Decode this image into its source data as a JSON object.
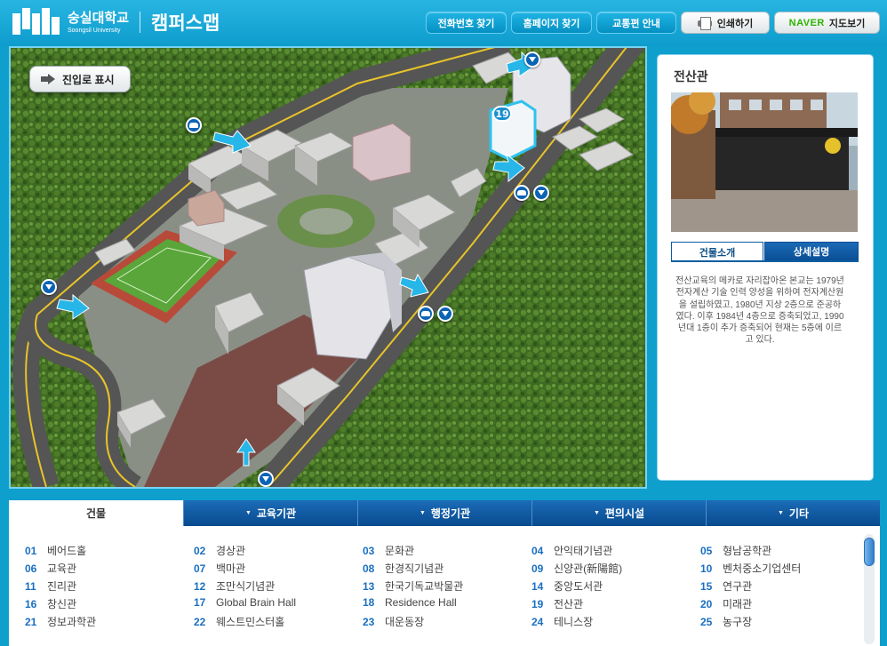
{
  "header": {
    "logo_kr": "숭실대학교",
    "logo_en": "Soongsil University",
    "page_title": "캠퍼스맵",
    "buttons": {
      "phone": "전화번호 찾기",
      "homepage": "홈페이지 찾기",
      "transport": "교통편 안내",
      "print": "인쇄하기",
      "naver_brand": "NAVER",
      "naver_map": "지도보기"
    }
  },
  "map": {
    "entrance_button": "진입로 표시",
    "selected_building_number": "19"
  },
  "info_panel": {
    "title": "전산관",
    "tab_intro": "건물소개",
    "tab_detail": "상세설명",
    "description": "전산교육의 메카로 자리잡아온 본교는 1979년 전자계산 기술 인력 양성을 위하여 전자계산원을 설립하였고, 1980년 지상 2층으로 준공하였다. 이후 1984년 4층으로 증축되었고, 1990년대 1층이 추가 증축되어 현재는 5층에 이르고 있다."
  },
  "categories": {
    "building": "건물",
    "education": "교육기관",
    "admin": "행정기관",
    "convenience": "편의시설",
    "etc": "기타"
  },
  "buildings": [
    {
      "num": "01",
      "name": "베어드홀"
    },
    {
      "num": "02",
      "name": "경상관"
    },
    {
      "num": "03",
      "name": "문화관"
    },
    {
      "num": "04",
      "name": "안익태기념관"
    },
    {
      "num": "05",
      "name": "형남공학관"
    },
    {
      "num": "06",
      "name": "교육관"
    },
    {
      "num": "07",
      "name": "백마관"
    },
    {
      "num": "08",
      "name": "한경직기념관"
    },
    {
      "num": "09",
      "name": "신양관(新陽館)"
    },
    {
      "num": "10",
      "name": "벤처중소기업센터"
    },
    {
      "num": "11",
      "name": "진리관"
    },
    {
      "num": "12",
      "name": "조만식기념관"
    },
    {
      "num": "13",
      "name": "한국기독교박물관"
    },
    {
      "num": "14",
      "name": "중앙도서관"
    },
    {
      "num": "15",
      "name": "연구관"
    },
    {
      "num": "16",
      "name": "창신관"
    },
    {
      "num": "17",
      "name": "Global Brain Hall"
    },
    {
      "num": "18",
      "name": "Residence Hall"
    },
    {
      "num": "19",
      "name": "전산관"
    },
    {
      "num": "20",
      "name": "미래관"
    },
    {
      "num": "21",
      "name": "정보과학관"
    },
    {
      "num": "22",
      "name": "웨스트민스터홀"
    },
    {
      "num": "23",
      "name": "대운동장"
    },
    {
      "num": "24",
      "name": "테니스장"
    },
    {
      "num": "25",
      "name": "농구장"
    }
  ]
}
